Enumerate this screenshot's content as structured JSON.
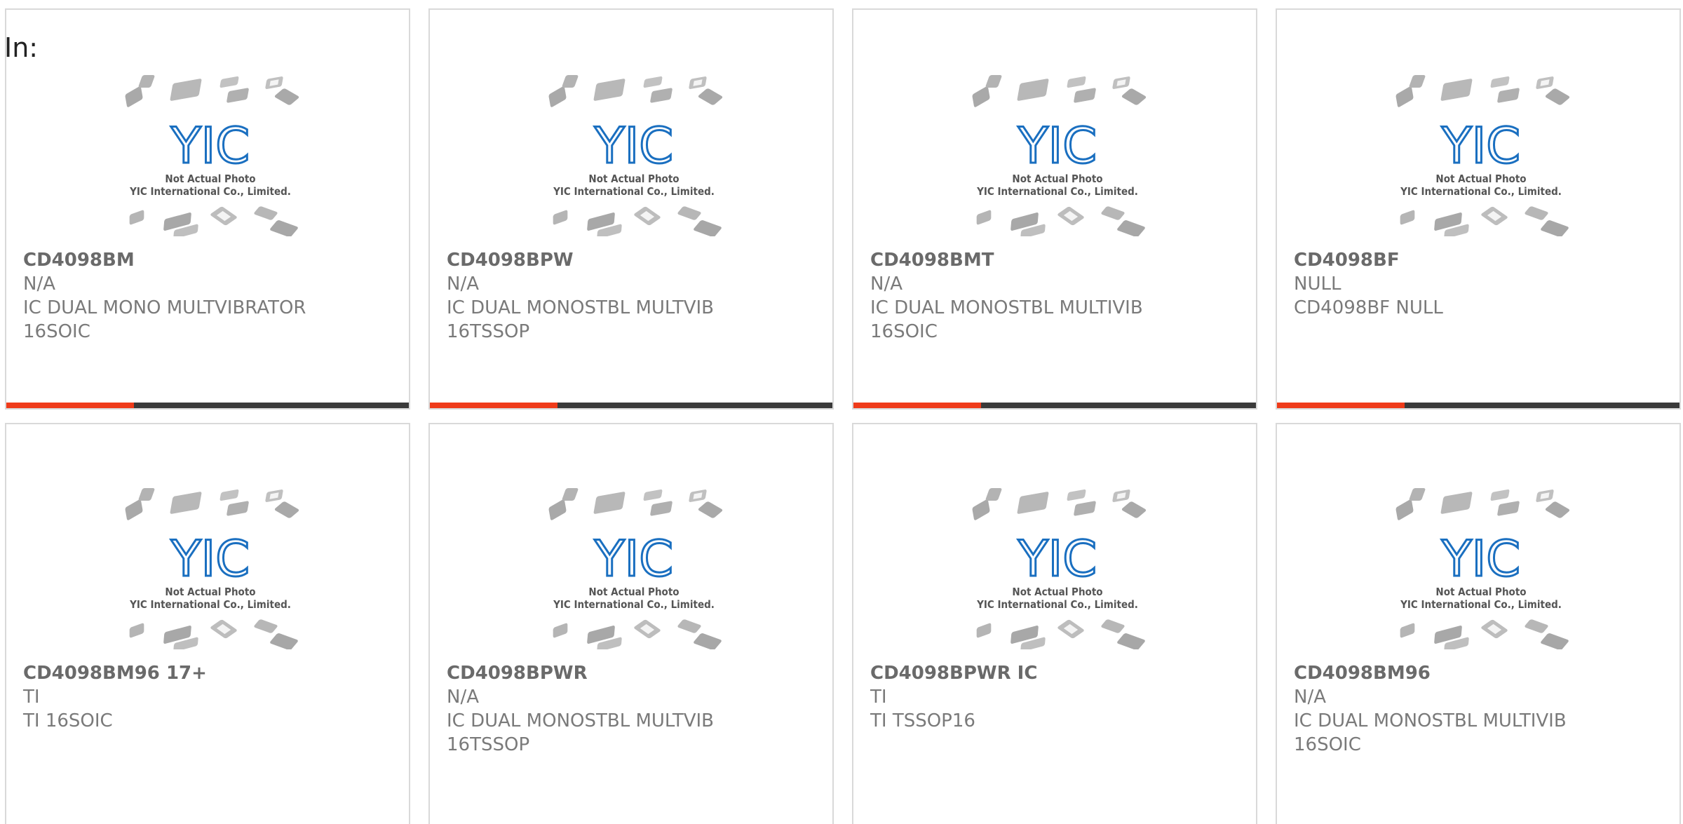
{
  "page": {
    "label": "In:",
    "photo_caption_1": "Not Actual Photo",
    "photo_caption_2": "YIC International Co., Limited.",
    "logo_text": "YIC"
  },
  "colors": {
    "accent": "#ef3b1a",
    "bar_dark": "#3a3a3a",
    "logo_blue": "#1a6fc0"
  },
  "products": [
    {
      "part_number": "CD4098BM",
      "manufacturer": "N/A",
      "description": "IC DUAL MONO MULTVIBRATOR",
      "description_2": "16SOIC"
    },
    {
      "part_number": "CD4098BPW",
      "manufacturer": "N/A",
      "description": "IC DUAL MONOSTBL MULTVIB",
      "description_2": "16TSSOP"
    },
    {
      "part_number": "CD4098BMT",
      "manufacturer": "N/A",
      "description": "IC DUAL MONOSTBL MULTIVIB",
      "description_2": "16SOIC"
    },
    {
      "part_number": "CD4098BF",
      "manufacturer": "NULL",
      "description": "CD4098BF NULL",
      "description_2": ""
    },
    {
      "part_number": "CD4098BM96 17+",
      "manufacturer": "TI",
      "description": "TI 16SOIC",
      "description_2": ""
    },
    {
      "part_number": "CD4098BPWR",
      "manufacturer": "N/A",
      "description": "IC DUAL MONOSTBL MULTVIB",
      "description_2": "16TSSOP"
    },
    {
      "part_number": "CD4098BPWR IC",
      "manufacturer": "TI",
      "description": "TI TSSOP16",
      "description_2": ""
    },
    {
      "part_number": "CD4098BM96",
      "manufacturer": "N/A",
      "description": "IC DUAL MONOSTBL MULTIVIB",
      "description_2": "16SOIC"
    }
  ]
}
